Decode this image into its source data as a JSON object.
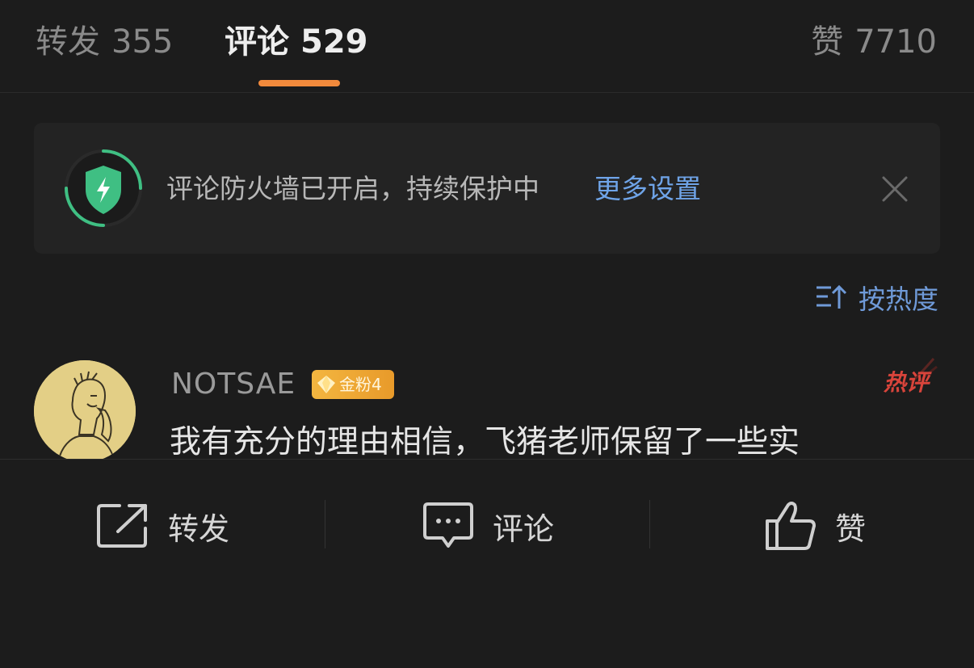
{
  "tabs": {
    "repost_label": "转发",
    "repost_count": "355",
    "comment_label": "评论",
    "comment_count": "529",
    "like_label": "赞",
    "like_count": "7710"
  },
  "banner": {
    "text": "评论防火墙已开启，持续保护中",
    "link": "更多设置",
    "icon": "shield-lightning-icon"
  },
  "sort": {
    "label": "按热度",
    "icon": "sort-icon"
  },
  "comment": {
    "username": "NOTSAE",
    "badge": "金粉4",
    "hot_tag": "热评",
    "text": "我有充分的理由相信，飞猪老师保留了一些实"
  },
  "actions": {
    "repost": "转发",
    "comment": "评论",
    "like": "赞"
  },
  "colors": {
    "background": "#1c1c1c",
    "accent_orange": "#f28a3c",
    "link_blue": "#6fa4e8",
    "shield_green": "#3fbf83",
    "hot_red": "#d8443b",
    "badge_gold": "#f3b640"
  }
}
